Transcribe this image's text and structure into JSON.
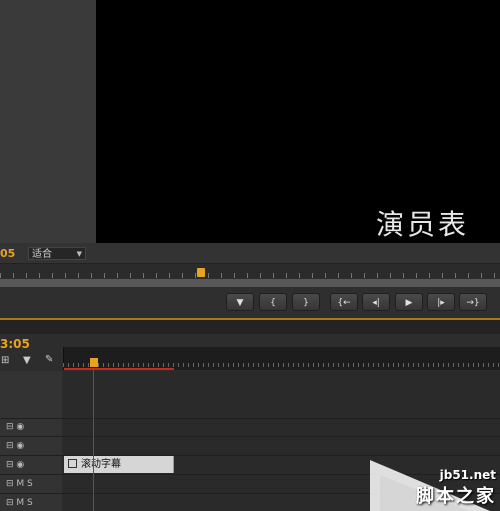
{
  "program_monitor": {
    "overlay_text": "演员表",
    "timecode": "05",
    "fit_label": "适合",
    "controls": [
      {
        "icon": "marker-icon",
        "label": "▼"
      },
      {
        "icon": "mark-in-icon",
        "label": "{"
      },
      {
        "icon": "mark-out-icon",
        "label": "}"
      },
      {
        "icon": "go-to-in-icon",
        "label": "{←"
      },
      {
        "icon": "step-back-icon",
        "label": "◂|"
      },
      {
        "icon": "play-icon",
        "label": "▶"
      },
      {
        "icon": "step-forward-icon",
        "label": "|▸"
      },
      {
        "icon": "go-to-out-icon",
        "label": "→}"
      }
    ]
  },
  "timeline": {
    "timecode": "3:05",
    "tracks": [
      {
        "type": "video",
        "icons": "⊟ ◉"
      },
      {
        "type": "video",
        "icons": "⊟ ◉"
      },
      {
        "type": "video",
        "icons": "⊟ ◉"
      },
      {
        "type": "audio",
        "icons": "⊟ M S"
      },
      {
        "type": "audio",
        "icons": "⊟ M S"
      }
    ],
    "clip_label": "滚动字幕"
  },
  "watermark": {
    "site": "jb51.net",
    "name": "脚本之家"
  }
}
